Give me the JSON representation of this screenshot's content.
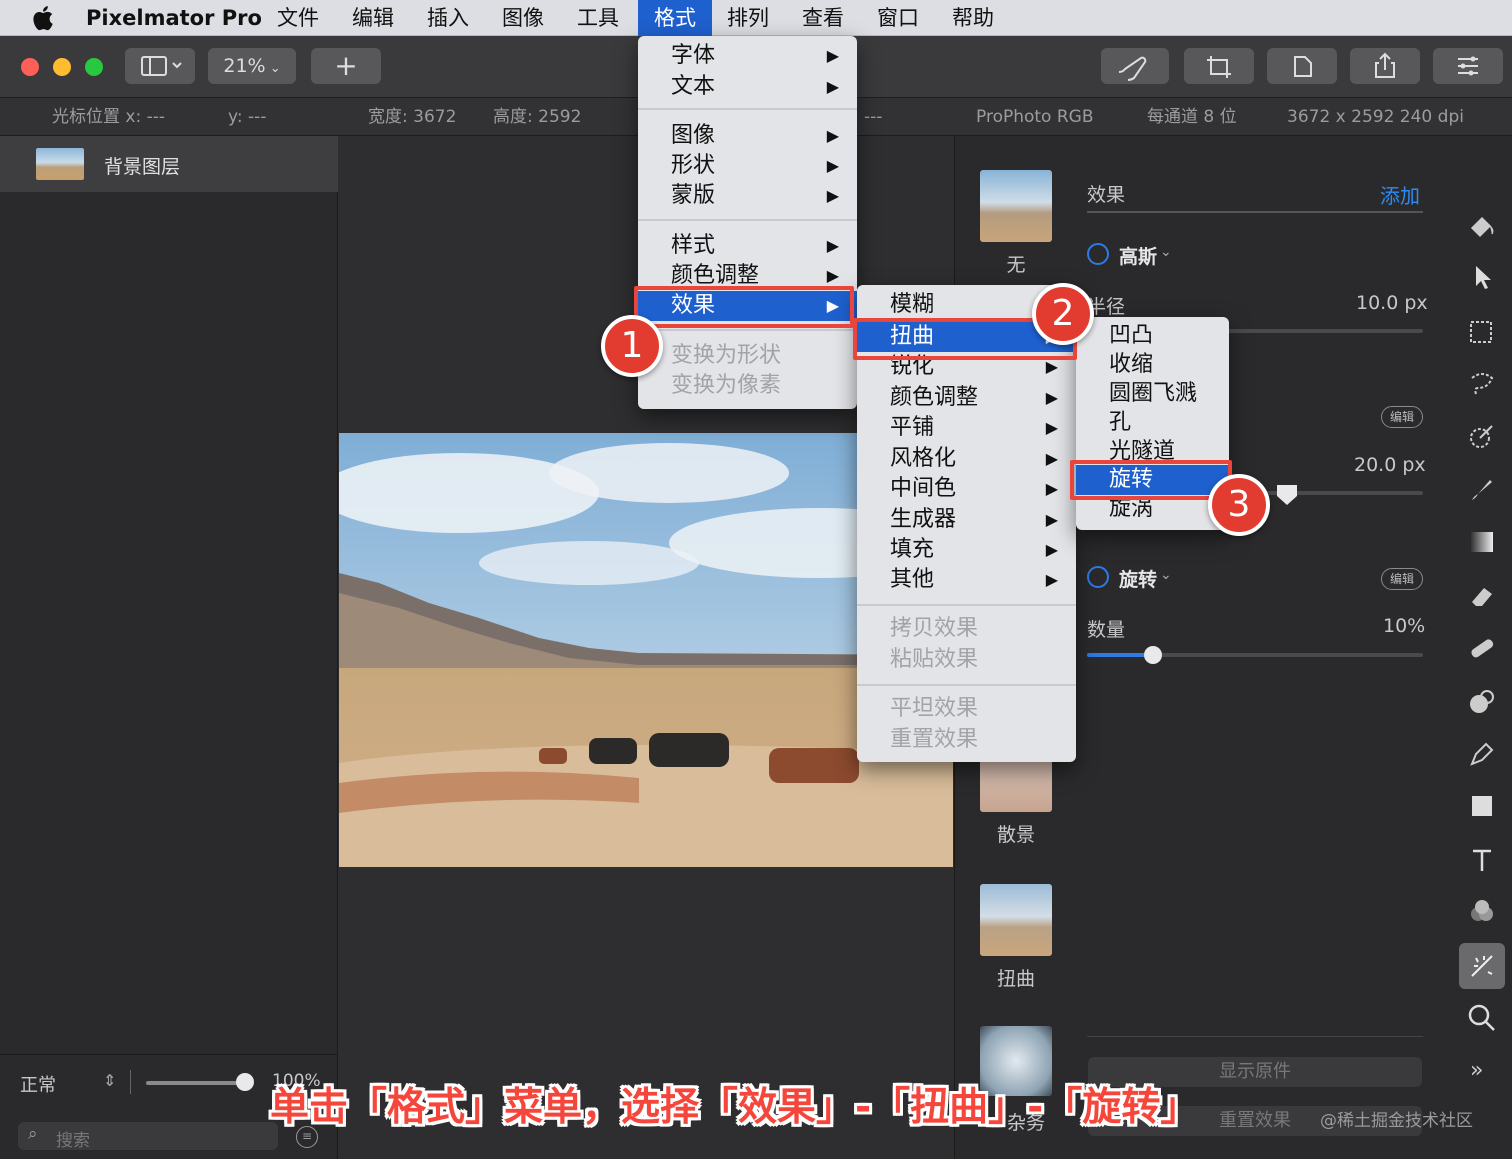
{
  "menubar": {
    "app_name": "Pixelmator Pro",
    "items": [
      "文件",
      "编辑",
      "插入",
      "图像",
      "工具",
      "格式",
      "排列",
      "查看",
      "窗口",
      "帮助"
    ],
    "active": "格式"
  },
  "toolbar": {
    "zoom": "21%",
    "add": "+"
  },
  "infobar": {
    "cursor_x": "光标位置 x:  ---",
    "cursor_y": "y:  ---",
    "width": "宽度:  3672",
    "height": "高度:  2592",
    "dash": "---",
    "colorspace": "ProPhoto RGB",
    "bits": "每通道 8 位",
    "size": "3672 x 2592 240 dpi"
  },
  "layers": {
    "layer_name": "背景图层",
    "blend_mode": "正常",
    "opacity": "100%",
    "search_placeholder": "搜索"
  },
  "format_menu": {
    "items": [
      "字体",
      "文本",
      "图像",
      "形状",
      "蒙版",
      "样式",
      "颜色调整",
      "效果",
      "变换为形状",
      "变换为像素"
    ]
  },
  "effects_submenu": {
    "items": [
      "模糊",
      "扭曲",
      "锐化",
      "颜色调整",
      "平铺",
      "风格化",
      "中间色",
      "生成器",
      "填充",
      "其他",
      "拷贝效果",
      "粘贴效果",
      "平坦效果",
      "重置效果"
    ]
  },
  "distort_submenu": {
    "items": [
      "凹凸",
      "收缩",
      "圆圈飞溅",
      "孔",
      "光隧道",
      "旋转",
      "旋涡"
    ]
  },
  "effects_panel": {
    "title": "效果",
    "add": "添加",
    "gauss_name": "高斯",
    "radius_label": "半径",
    "radius_value": "10.0 px",
    "edit_label": "编辑",
    "second_value": "20.0 px",
    "rotate_name": "旋转",
    "amount_label": "数量",
    "amount_value": "10%",
    "amount_fraction": 0.1,
    "show_original": "显示原件",
    "reset_effects": "重置效果"
  },
  "thumbnails": {
    "none": "无",
    "bokeh": "散景",
    "distort": "扭曲",
    "misc": "杂务"
  },
  "annotations": {
    "badge1": "1",
    "badge2": "2",
    "badge3": "3",
    "caption": "单击「格式」菜单，选择「效果」-「扭曲」-「旋转」",
    "watermark": "@稀土掘金技术社区"
  },
  "colors": {
    "accent": "#1f60cf",
    "annotation_red": "#e8463c",
    "link_blue": "#2c8cf4"
  }
}
